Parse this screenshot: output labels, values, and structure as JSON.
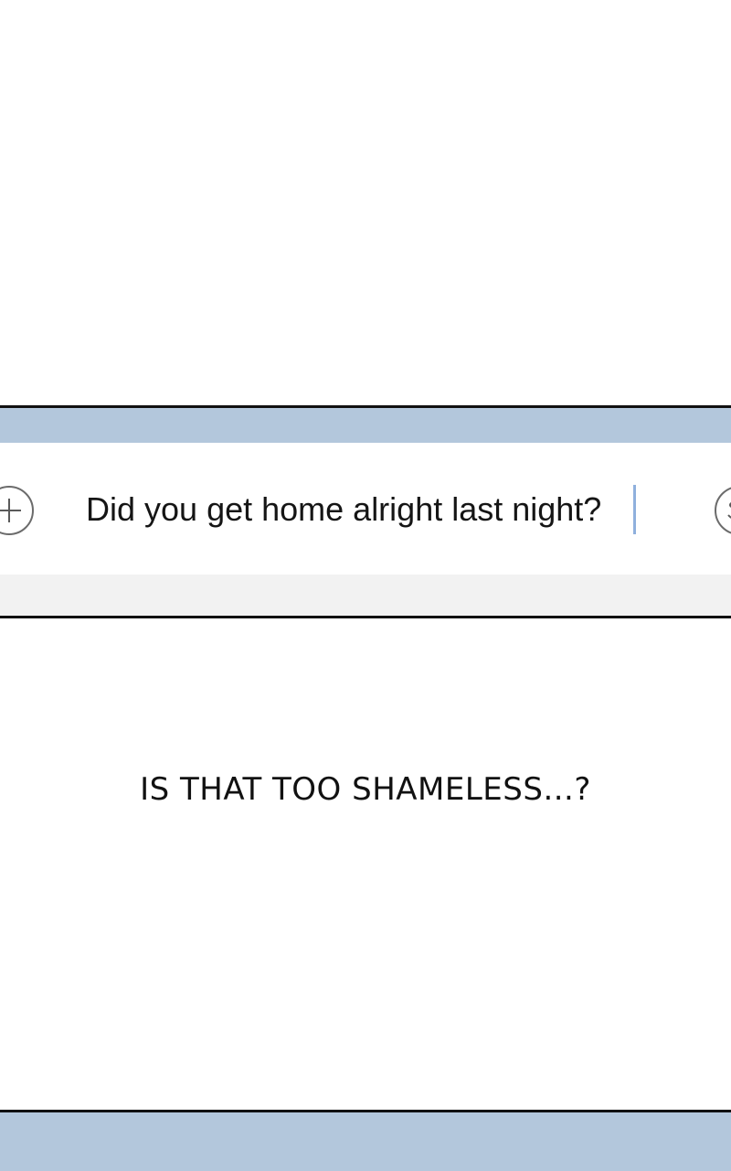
{
  "compose": {
    "message_text": "Did you get home alright last night?",
    "plus_icon": "plus-circle-icon",
    "right_icon": "emoji-icon",
    "accent_bar_color": "#b3c7dc",
    "caret_color": "#8fb0dd"
  },
  "narration": {
    "caption": "IS THAT TOO SHAMELESS...?"
  }
}
